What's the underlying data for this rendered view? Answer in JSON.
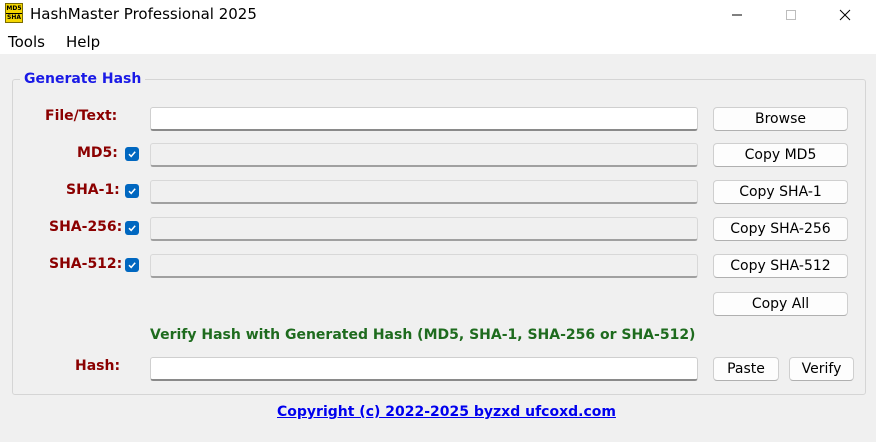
{
  "window": {
    "title": "HashMaster Professional 2025",
    "icon_text_top": "MD5",
    "icon_text_bottom": "SHA"
  },
  "menu": {
    "items": [
      "Tools",
      "Help"
    ]
  },
  "generate": {
    "group_title": "Generate Hash",
    "file_label": "File/Text:",
    "file_value": "",
    "browse_label": "Browse",
    "rows": [
      {
        "label": "MD5:",
        "checked": true,
        "value": "",
        "copy_label": "Copy MD5"
      },
      {
        "label": "SHA-1:",
        "checked": true,
        "value": "",
        "copy_label": "Copy SHA-1"
      },
      {
        "label": "SHA-256:",
        "checked": true,
        "value": "",
        "copy_label": "Copy SHA-256"
      },
      {
        "label": "SHA-512:",
        "checked": true,
        "value": "",
        "copy_label": "Copy SHA-512"
      }
    ],
    "copy_all_label": "Copy All"
  },
  "verify": {
    "heading": "Verify Hash with Generated Hash (MD5, SHA-1, SHA-256 or SHA-512)",
    "hash_label": "Hash:",
    "hash_value": "",
    "paste_label": "Paste",
    "verify_label": "Verify"
  },
  "footer": {
    "copyright": "Copyright (c) 2022-2025 byzxd ufcoxd.com"
  },
  "colors": {
    "label_red": "#8b0000",
    "group_title_blue": "#1a1ae6",
    "verify_green": "#1e6b1e",
    "link_blue": "#0000ee",
    "checkbox_blue": "#0067c0"
  }
}
